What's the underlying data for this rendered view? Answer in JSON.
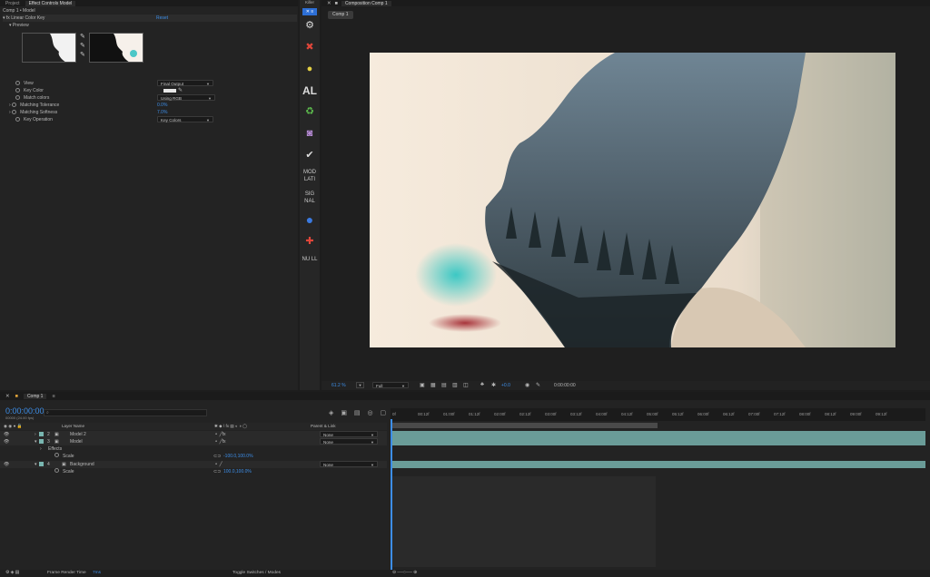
{
  "effect_controls": {
    "tabs": [
      "Project",
      "Effect Controls Model"
    ],
    "breadcrumb": "Comp 1 • Model",
    "effect_name": "Linear Color Key",
    "reset_label": "Reset",
    "preview_label": "Preview",
    "props": [
      {
        "label": "View",
        "value": "Final Output"
      },
      {
        "label": "Key Color",
        "value": ""
      },
      {
        "label": "Match colors",
        "value": "Using RGB"
      },
      {
        "label": "Matching Tolerance",
        "value": "0.0%"
      },
      {
        "label": "Matching Softness",
        "value": "7.0%"
      },
      {
        "label": "Key Operation",
        "value": "Key Colors"
      }
    ]
  },
  "plugins": {
    "title": "Killer",
    "label_al": "AL",
    "label_mod": "MOD LATI",
    "label_sig": "SIG NAL",
    "label_nu": "NU LL",
    "icons": [
      "gear-icon",
      "crosshair-icon",
      "bulb-icon",
      "recycle-icon",
      "camera-icon",
      "check-icon",
      "circle-icon",
      "target-icon"
    ]
  },
  "composition": {
    "panel_title": "Composition Comp 1",
    "tab": "Comp 1",
    "zoom": "61.2",
    "zoom_unit": "%",
    "resolution": "Full",
    "exposure": "+0.0",
    "timecode": "0:00:00:00"
  },
  "timeline": {
    "tab": "Comp 1",
    "current_time": "0:00:00:00",
    "fps_info": "00000 (24.00 fps)",
    "search_placeholder": "",
    "col_layer_name": "Layer Name",
    "col_parent": "Parent & Link",
    "ruler": [
      "0f",
      "00:12f",
      "01:00f",
      "01:12f",
      "02:00f",
      "02:12f",
      "03:00f",
      "03:12f",
      "04:00f",
      "04:12f",
      "05:00f",
      "05:12f",
      "06:00f",
      "06:12f",
      "07:00f",
      "07:12f",
      "08:00f",
      "08:12f",
      "09:00f",
      "09:12f"
    ],
    "layers": [
      {
        "num": "2",
        "name": "Model 2",
        "parent": "None"
      },
      {
        "num": "3",
        "name": "Model",
        "parent": "None"
      },
      {
        "num": "",
        "name": "Effects",
        "parent": ""
      },
      {
        "num": "",
        "name": "Scale",
        "value": "-100.0,100.0%"
      },
      {
        "num": "4",
        "name": "Background",
        "parent": "None"
      },
      {
        "num": "",
        "name": "Scale",
        "value": "100.0,100.0%"
      }
    ],
    "footer_left": "Frame Render Time",
    "footer_left_value": "7ms",
    "footer_center": "Toggle Switches / Modes"
  },
  "colors": {
    "accent": "#3d8ee8",
    "bar": "#6a9c98"
  }
}
